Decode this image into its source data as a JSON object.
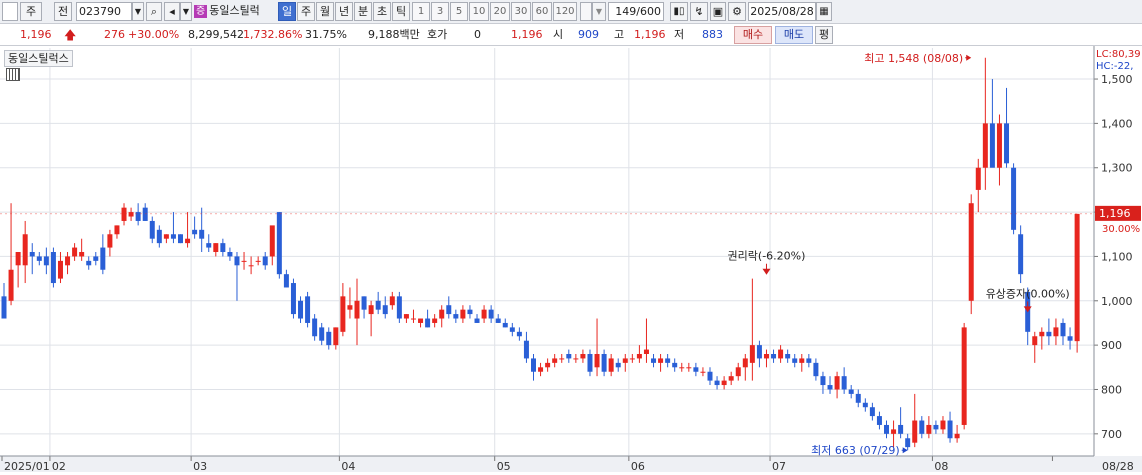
{
  "toolbar": {
    "market": "주",
    "prev_label": "전",
    "code": "023790",
    "badge": "증",
    "stock_name": "동일스틸럭",
    "periods": [
      "일",
      "주",
      "월",
      "년",
      "분",
      "초",
      "틱"
    ],
    "selected_period": "일",
    "intervals": [
      "1",
      "3",
      "5",
      "10",
      "20",
      "30",
      "60",
      "120"
    ],
    "count": "149/600",
    "date": "2025/08/28"
  },
  "quote": {
    "price": "1,196",
    "change": "276",
    "change_pct": "+30.00%",
    "volume": "8,299,542",
    "vol_ratio": "1,732.86%",
    "turnover": "31.75%",
    "amount": "9,188백만",
    "hoga_label": "호가",
    "hoga_value": "0",
    "hoga_price": "1,196",
    "open_label": "시",
    "open": "909",
    "high_label": "고",
    "high": "1,196",
    "low_label": "저",
    "low": "883",
    "buy": "매수",
    "sell": "매도",
    "avg": "평"
  },
  "chart_title": "동일스틸럭스",
  "chart_data": {
    "type": "candlestick",
    "y_ticks": [
      700,
      800,
      900,
      1000,
      1100,
      1200,
      1300,
      1400,
      1500
    ],
    "y_tick_labels": [
      "700",
      "800",
      "900",
      "1,000",
      "1,100",
      "1,200",
      "1,300",
      "1,400",
      "1,500"
    ],
    "ylim": [
      650,
      1570
    ],
    "x_labels": [
      {
        "i": 0,
        "label": "2025/01"
      },
      {
        "i": 7,
        "label": "02"
      },
      {
        "i": 27,
        "label": "03"
      },
      {
        "i": 48,
        "label": "04"
      },
      {
        "i": 70,
        "label": "05"
      },
      {
        "i": 89,
        "label": "06"
      },
      {
        "i": 109,
        "label": "07"
      },
      {
        "i": 132,
        "label": "08"
      },
      {
        "i": 149,
        "label": "08/28"
      }
    ],
    "current_price": {
      "value": 1196,
      "label": "1,196",
      "pct": "30.00%"
    },
    "corner_labels": [
      "LC:80,39",
      "HC:-22,"
    ],
    "annotations": [
      {
        "text": "최고 1,548 (08/08)",
        "i": 137,
        "value": 1548,
        "color": "#d21d1d",
        "kind": "high"
      },
      {
        "text": "최저 663 (07/29)",
        "i": 128,
        "value": 663,
        "color": "#1f47c8",
        "kind": "low"
      },
      {
        "text": "권리락(-6.20%)",
        "i": 108,
        "value": 1070,
        "color": "#222222",
        "kind": "event"
      },
      {
        "text": "유상증자(0.00%)",
        "i": 145,
        "value": 985,
        "color": "#222222",
        "kind": "event"
      }
    ],
    "candles": [
      {
        "o": 1010,
        "h": 1040,
        "l": 960,
        "c": 960
      },
      {
        "o": 1000,
        "h": 1220,
        "l": 990,
        "c": 1070
      },
      {
        "o": 1080,
        "h": 1100,
        "l": 1030,
        "c": 1110
      },
      {
        "o": 1080,
        "h": 1180,
        "l": 1040,
        "c": 1150
      },
      {
        "o": 1110,
        "h": 1130,
        "l": 1060,
        "c": 1100
      },
      {
        "o": 1100,
        "h": 1110,
        "l": 1080,
        "c": 1090
      },
      {
        "o": 1100,
        "h": 1120,
        "l": 1060,
        "c": 1080
      },
      {
        "o": 1110,
        "h": 1120,
        "l": 1030,
        "c": 1040
      },
      {
        "o": 1050,
        "h": 1110,
        "l": 1040,
        "c": 1090
      },
      {
        "o": 1080,
        "h": 1110,
        "l": 1060,
        "c": 1100
      },
      {
        "o": 1100,
        "h": 1130,
        "l": 1090,
        "c": 1120
      },
      {
        "o": 1100,
        "h": 1140,
        "l": 1090,
        "c": 1110
      },
      {
        "o": 1090,
        "h": 1100,
        "l": 1070,
        "c": 1080
      },
      {
        "o": 1100,
        "h": 1110,
        "l": 1080,
        "c": 1090
      },
      {
        "o": 1120,
        "h": 1150,
        "l": 1060,
        "c": 1070
      },
      {
        "o": 1120,
        "h": 1160,
        "l": 1100,
        "c": 1150
      },
      {
        "o": 1150,
        "h": 1170,
        "l": 1140,
        "c": 1170
      },
      {
        "o": 1180,
        "h": 1220,
        "l": 1170,
        "c": 1210
      },
      {
        "o": 1190,
        "h": 1210,
        "l": 1180,
        "c": 1200
      },
      {
        "o": 1200,
        "h": 1220,
        "l": 1170,
        "c": 1180
      },
      {
        "o": 1210,
        "h": 1220,
        "l": 1180,
        "c": 1180
      },
      {
        "o": 1180,
        "h": 1190,
        "l": 1130,
        "c": 1140
      },
      {
        "o": 1160,
        "h": 1170,
        "l": 1120,
        "c": 1130
      },
      {
        "o": 1140,
        "h": 1150,
        "l": 1130,
        "c": 1150
      },
      {
        "o": 1150,
        "h": 1200,
        "l": 1130,
        "c": 1140
      },
      {
        "o": 1150,
        "h": 1150,
        "l": 1130,
        "c": 1130
      },
      {
        "o": 1130,
        "h": 1200,
        "l": 1120,
        "c": 1140
      },
      {
        "o": 1160,
        "h": 1190,
        "l": 1140,
        "c": 1150
      },
      {
        "o": 1160,
        "h": 1210,
        "l": 1110,
        "c": 1140
      },
      {
        "o": 1130,
        "h": 1150,
        "l": 1110,
        "c": 1120
      },
      {
        "o": 1110,
        "h": 1130,
        "l": 1100,
        "c": 1130
      },
      {
        "o": 1130,
        "h": 1140,
        "l": 1100,
        "c": 1110
      },
      {
        "o": 1110,
        "h": 1120,
        "l": 1090,
        "c": 1100
      },
      {
        "o": 1100,
        "h": 1110,
        "l": 1000,
        "c": 1080
      },
      {
        "o": 1090,
        "h": 1110,
        "l": 1070,
        "c": 1090
      },
      {
        "o": 1080,
        "h": 1100,
        "l": 1060,
        "c": 1080
      },
      {
        "o": 1090,
        "h": 1100,
        "l": 1080,
        "c": 1090
      },
      {
        "o": 1100,
        "h": 1110,
        "l": 1070,
        "c": 1080
      },
      {
        "o": 1100,
        "h": 1120,
        "l": 1080,
        "c": 1170
      },
      {
        "o": 1200,
        "h": 1200,
        "l": 1050,
        "c": 1060
      },
      {
        "o": 1060,
        "h": 1070,
        "l": 1030,
        "c": 1030
      },
      {
        "o": 1040,
        "h": 1050,
        "l": 960,
        "c": 970
      },
      {
        "o": 1000,
        "h": 1010,
        "l": 950,
        "c": 960
      },
      {
        "o": 1010,
        "h": 1020,
        "l": 940,
        "c": 950
      },
      {
        "o": 960,
        "h": 970,
        "l": 910,
        "c": 920
      },
      {
        "o": 940,
        "h": 950,
        "l": 900,
        "c": 910
      },
      {
        "o": 930,
        "h": 940,
        "l": 890,
        "c": 900
      },
      {
        "o": 900,
        "h": 940,
        "l": 890,
        "c": 940
      },
      {
        "o": 930,
        "h": 1040,
        "l": 920,
        "c": 1010
      },
      {
        "o": 980,
        "h": 1030,
        "l": 960,
        "c": 990
      },
      {
        "o": 960,
        "h": 1050,
        "l": 900,
        "c": 1000
      },
      {
        "o": 1010,
        "h": 1010,
        "l": 960,
        "c": 980
      },
      {
        "o": 970,
        "h": 1000,
        "l": 920,
        "c": 990
      },
      {
        "o": 1000,
        "h": 1020,
        "l": 970,
        "c": 980
      },
      {
        "o": 990,
        "h": 1010,
        "l": 960,
        "c": 970
      },
      {
        "o": 990,
        "h": 1020,
        "l": 980,
        "c": 1010
      },
      {
        "o": 1010,
        "h": 1020,
        "l": 950,
        "c": 960
      },
      {
        "o": 960,
        "h": 970,
        "l": 950,
        "c": 970
      },
      {
        "o": 960,
        "h": 980,
        "l": 950,
        "c": 960
      },
      {
        "o": 950,
        "h": 960,
        "l": 940,
        "c": 960
      },
      {
        "o": 960,
        "h": 980,
        "l": 940,
        "c": 940
      },
      {
        "o": 950,
        "h": 970,
        "l": 940,
        "c": 960
      },
      {
        "o": 960,
        "h": 990,
        "l": 940,
        "c": 980
      },
      {
        "o": 990,
        "h": 1010,
        "l": 960,
        "c": 970
      },
      {
        "o": 970,
        "h": 980,
        "l": 950,
        "c": 960
      },
      {
        "o": 960,
        "h": 990,
        "l": 950,
        "c": 980
      },
      {
        "o": 980,
        "h": 990,
        "l": 960,
        "c": 970
      },
      {
        "o": 960,
        "h": 970,
        "l": 950,
        "c": 950
      },
      {
        "o": 960,
        "h": 990,
        "l": 950,
        "c": 980
      },
      {
        "o": 980,
        "h": 990,
        "l": 950,
        "c": 960
      },
      {
        "o": 960,
        "h": 970,
        "l": 950,
        "c": 950
      },
      {
        "o": 950,
        "h": 960,
        "l": 940,
        "c": 940
      },
      {
        "o": 940,
        "h": 950,
        "l": 920,
        "c": 930
      },
      {
        "o": 930,
        "h": 940,
        "l": 910,
        "c": 920
      },
      {
        "o": 910,
        "h": 930,
        "l": 860,
        "c": 870
      },
      {
        "o": 870,
        "h": 880,
        "l": 820,
        "c": 840
      },
      {
        "o": 840,
        "h": 860,
        "l": 830,
        "c": 850
      },
      {
        "o": 850,
        "h": 870,
        "l": 840,
        "c": 860
      },
      {
        "o": 860,
        "h": 880,
        "l": 850,
        "c": 870
      },
      {
        "o": 870,
        "h": 880,
        "l": 860,
        "c": 870
      },
      {
        "o": 880,
        "h": 890,
        "l": 860,
        "c": 870
      },
      {
        "o": 870,
        "h": 880,
        "l": 860,
        "c": 870
      },
      {
        "o": 870,
        "h": 890,
        "l": 860,
        "c": 880
      },
      {
        "o": 880,
        "h": 890,
        "l": 830,
        "c": 840
      },
      {
        "o": 850,
        "h": 960,
        "l": 830,
        "c": 880
      },
      {
        "o": 880,
        "h": 890,
        "l": 830,
        "c": 840
      },
      {
        "o": 840,
        "h": 880,
        "l": 830,
        "c": 870
      },
      {
        "o": 860,
        "h": 870,
        "l": 840,
        "c": 850
      },
      {
        "o": 860,
        "h": 880,
        "l": 840,
        "c": 870
      },
      {
        "o": 870,
        "h": 880,
        "l": 860,
        "c": 870
      },
      {
        "o": 870,
        "h": 900,
        "l": 860,
        "c": 880
      },
      {
        "o": 880,
        "h": 960,
        "l": 860,
        "c": 890
      },
      {
        "o": 870,
        "h": 880,
        "l": 850,
        "c": 860
      },
      {
        "o": 860,
        "h": 880,
        "l": 840,
        "c": 870
      },
      {
        "o": 870,
        "h": 880,
        "l": 850,
        "c": 860
      },
      {
        "o": 860,
        "h": 870,
        "l": 840,
        "c": 850
      },
      {
        "o": 850,
        "h": 860,
        "l": 840,
        "c": 850
      },
      {
        "o": 850,
        "h": 860,
        "l": 840,
        "c": 850
      },
      {
        "o": 850,
        "h": 860,
        "l": 830,
        "c": 840
      },
      {
        "o": 840,
        "h": 850,
        "l": 830,
        "c": 840
      },
      {
        "o": 840,
        "h": 850,
        "l": 810,
        "c": 820
      },
      {
        "o": 820,
        "h": 830,
        "l": 800,
        "c": 810
      },
      {
        "o": 810,
        "h": 830,
        "l": 800,
        "c": 820
      },
      {
        "o": 820,
        "h": 840,
        "l": 810,
        "c": 830
      },
      {
        "o": 830,
        "h": 860,
        "l": 820,
        "c": 850
      },
      {
        "o": 850,
        "h": 880,
        "l": 820,
        "c": 870
      },
      {
        "o": 860,
        "h": 1050,
        "l": 820,
        "c": 900
      },
      {
        "o": 900,
        "h": 910,
        "l": 850,
        "c": 870
      },
      {
        "o": 870,
        "h": 890,
        "l": 850,
        "c": 880
      },
      {
        "o": 880,
        "h": 890,
        "l": 860,
        "c": 870
      },
      {
        "o": 870,
        "h": 900,
        "l": 860,
        "c": 890
      },
      {
        "o": 880,
        "h": 890,
        "l": 860,
        "c": 870
      },
      {
        "o": 870,
        "h": 880,
        "l": 850,
        "c": 860
      },
      {
        "o": 860,
        "h": 880,
        "l": 840,
        "c": 870
      },
      {
        "o": 870,
        "h": 880,
        "l": 850,
        "c": 860
      },
      {
        "o": 860,
        "h": 870,
        "l": 820,
        "c": 830
      },
      {
        "o": 830,
        "h": 840,
        "l": 790,
        "c": 810
      },
      {
        "o": 810,
        "h": 830,
        "l": 790,
        "c": 800
      },
      {
        "o": 800,
        "h": 840,
        "l": 780,
        "c": 830
      },
      {
        "o": 830,
        "h": 850,
        "l": 790,
        "c": 800
      },
      {
        "o": 800,
        "h": 810,
        "l": 780,
        "c": 790
      },
      {
        "o": 790,
        "h": 800,
        "l": 760,
        "c": 770
      },
      {
        "o": 770,
        "h": 780,
        "l": 750,
        "c": 760
      },
      {
        "o": 760,
        "h": 770,
        "l": 730,
        "c": 740
      },
      {
        "o": 740,
        "h": 750,
        "l": 710,
        "c": 720
      },
      {
        "o": 720,
        "h": 730,
        "l": 690,
        "c": 700
      },
      {
        "o": 700,
        "h": 730,
        "l": 670,
        "c": 710
      },
      {
        "o": 720,
        "h": 760,
        "l": 690,
        "c": 700
      },
      {
        "o": 690,
        "h": 700,
        "l": 663,
        "c": 670
      },
      {
        "o": 680,
        "h": 790,
        "l": 670,
        "c": 730
      },
      {
        "o": 730,
        "h": 740,
        "l": 690,
        "c": 700
      },
      {
        "o": 700,
        "h": 740,
        "l": 690,
        "c": 720
      },
      {
        "o": 720,
        "h": 730,
        "l": 700,
        "c": 710
      },
      {
        "o": 710,
        "h": 740,
        "l": 700,
        "c": 730
      },
      {
        "o": 730,
        "h": 750,
        "l": 680,
        "c": 690
      },
      {
        "o": 690,
        "h": 720,
        "l": 680,
        "c": 700
      },
      {
        "o": 720,
        "h": 950,
        "l": 710,
        "c": 940
      },
      {
        "o": 1000,
        "h": 1240,
        "l": 970,
        "c": 1220
      },
      {
        "o": 1250,
        "h": 1320,
        "l": 1200,
        "c": 1300
      },
      {
        "o": 1300,
        "h": 1548,
        "l": 1250,
        "c": 1400
      },
      {
        "o": 1400,
        "h": 1500,
        "l": 1340,
        "c": 1300
      },
      {
        "o": 1300,
        "h": 1420,
        "l": 1260,
        "c": 1400
      },
      {
        "o": 1400,
        "h": 1480,
        "l": 1300,
        "c": 1310
      },
      {
        "o": 1300,
        "h": 1310,
        "l": 1150,
        "c": 1160
      },
      {
        "o": 1150,
        "h": 1170,
        "l": 1040,
        "c": 1060
      },
      {
        "o": 1020,
        "h": 1030,
        "l": 900,
        "c": 930
      },
      {
        "o": 900,
        "h": 930,
        "l": 860,
        "c": 920
      },
      {
        "o": 920,
        "h": 940,
        "l": 890,
        "c": 930
      },
      {
        "o": 930,
        "h": 960,
        "l": 900,
        "c": 920
      },
      {
        "o": 920,
        "h": 960,
        "l": 900,
        "c": 940
      },
      {
        "o": 950,
        "h": 960,
        "l": 900,
        "c": 920
      },
      {
        "o": 920,
        "h": 940,
        "l": 890,
        "c": 910
      },
      {
        "o": 909,
        "h": 1196,
        "l": 883,
        "c": 1196
      }
    ]
  }
}
